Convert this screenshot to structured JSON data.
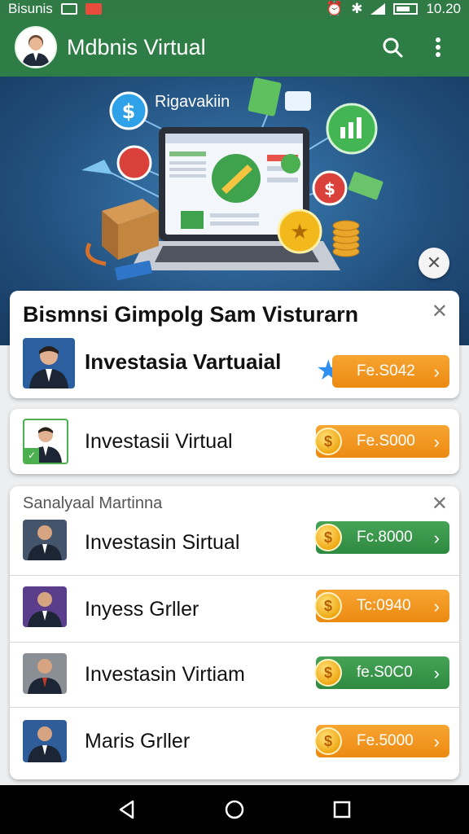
{
  "status_bar": {
    "carrier": "Bisunis",
    "time": "10.20"
  },
  "app_bar": {
    "title": "Mdbnis Virtual",
    "icons": [
      "avatar",
      "search-icon",
      "more-vert-icon"
    ]
  },
  "hero": {
    "label": "Rigavakiin"
  },
  "featured_card": {
    "title": "Bismnsi Gimpolg Sam Visturarn",
    "row": {
      "title": "Investasia Vartuaial",
      "cta": "Fe.S042",
      "cta_color": "orange",
      "badge": "star-icon"
    }
  },
  "row_single": {
    "title": "Investasii Virtual",
    "cta": "Fe.S000",
    "cta_color": "orange"
  },
  "group_card": {
    "subtitle": "Sanalyaal Martinna",
    "rows": [
      {
        "title": "Investasin Sirtual",
        "cta": "Fc.8000",
        "cta_color": "green"
      },
      {
        "title": "Inyess Grller",
        "cta": "Tc:0940",
        "cta_color": "orange"
      },
      {
        "title": "Investasin Virtiam",
        "cta": "fe.S0C0",
        "cta_color": "green"
      },
      {
        "title": "Maris Grller",
        "cta": "Fe.5000",
        "cta_color": "orange"
      }
    ]
  },
  "colors": {
    "primary": "#2e7d46",
    "orange": "#ec8a12",
    "green": "#2f8a41"
  }
}
